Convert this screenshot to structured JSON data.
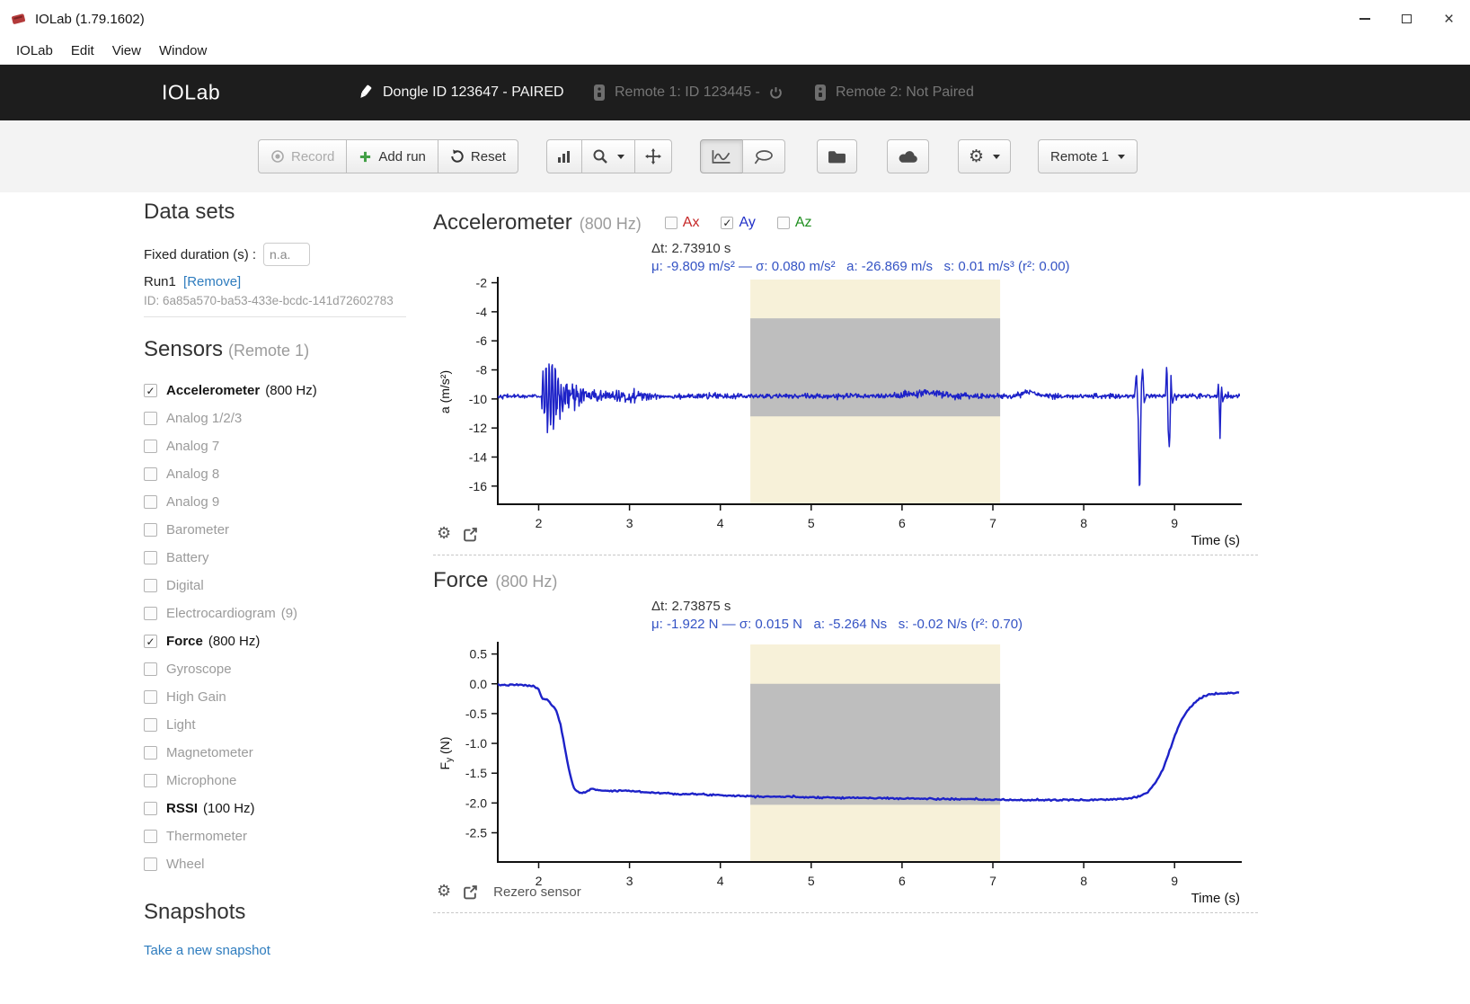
{
  "window": {
    "title": "IOLab (1.79.1602)"
  },
  "menu": [
    "IOLab",
    "Edit",
    "View",
    "Window"
  ],
  "header": {
    "brand": "IOLab",
    "dongle": "Dongle ID 123647 - PAIRED",
    "remote1": "Remote 1: ID 123445 -",
    "remote2": "Remote 2: Not Paired"
  },
  "toolbar": {
    "record": "Record",
    "add_run": "Add run",
    "reset": "Reset",
    "remote_select": "Remote 1"
  },
  "colors": {
    "series_blue": "#1d22c8",
    "stats_blue": "#3453c4",
    "link_blue": "#2e7cbe",
    "selection_yellow": "#f7f1d9",
    "selection_grey": "rgba(112,118,152,0.42)",
    "add_run_green": "#43a047"
  },
  "sidebar": {
    "datasets_title": "Data sets",
    "fixed_duration_label": "Fixed duration (s) :",
    "fixed_duration_value": "n.a.",
    "run_name": "Run1",
    "run_remove": "[Remove]",
    "run_id": "ID: 6a85a570-ba53-433e-bcdc-141d72602783",
    "sensors_title": "Sensors",
    "sensors_subtitle": "(Remote 1)",
    "sensors": [
      {
        "name": "Accelerometer",
        "rate": "(800 Hz)",
        "checked": true,
        "bold": true
      },
      {
        "name": "Analog 1/2/3",
        "rate": "",
        "checked": false,
        "bold": false
      },
      {
        "name": "Analog 7",
        "rate": "",
        "checked": false,
        "bold": false
      },
      {
        "name": "Analog 8",
        "rate": "",
        "checked": false,
        "bold": false
      },
      {
        "name": "Analog 9",
        "rate": "",
        "checked": false,
        "bold": false
      },
      {
        "name": "Barometer",
        "rate": "",
        "checked": false,
        "bold": false
      },
      {
        "name": "Battery",
        "rate": "",
        "checked": false,
        "bold": false
      },
      {
        "name": "Digital",
        "rate": "",
        "checked": false,
        "bold": false
      },
      {
        "name": "Electrocardiogram",
        "rate": "(9)",
        "checked": false,
        "bold": false
      },
      {
        "name": "Force",
        "rate": "(800 Hz)",
        "checked": true,
        "bold": true
      },
      {
        "name": "Gyroscope",
        "rate": "",
        "checked": false,
        "bold": false
      },
      {
        "name": "High Gain",
        "rate": "",
        "checked": false,
        "bold": false
      },
      {
        "name": "Light",
        "rate": "",
        "checked": false,
        "bold": false
      },
      {
        "name": "Magnetometer",
        "rate": "",
        "checked": false,
        "bold": false
      },
      {
        "name": "Microphone",
        "rate": "",
        "checked": false,
        "bold": false
      },
      {
        "name": "RSSI",
        "rate": "(100 Hz)",
        "checked": false,
        "bold": true
      },
      {
        "name": "Thermometer",
        "rate": "",
        "checked": false,
        "bold": false
      },
      {
        "name": "Wheel",
        "rate": "",
        "checked": false,
        "bold": false
      }
    ],
    "snapshots_title": "Snapshots",
    "snapshot_link": "Take a new snapshot"
  },
  "chart_data": [
    {
      "type": "line",
      "title": "Accelerometer",
      "title_rate": "(800 Hz)",
      "xlabel": "Time (s)",
      "ylabel": "a (m/s²)",
      "xlim": [
        1.55,
        9.72
      ],
      "ylim": [
        -17.25,
        -1.78
      ],
      "xticks": [
        {
          "v": 2,
          "l": "2"
        },
        {
          "v": 3,
          "l": "3"
        },
        {
          "v": 4,
          "l": "4"
        },
        {
          "v": 5,
          "l": "5"
        },
        {
          "v": 6,
          "l": "6"
        },
        {
          "v": 7,
          "l": "7"
        },
        {
          "v": 8,
          "l": "8"
        },
        {
          "v": 9,
          "l": "9"
        }
      ],
      "yticks": [
        {
          "v": -2,
          "l": "-2"
        },
        {
          "v": -4,
          "l": "-4"
        },
        {
          "v": -6,
          "l": "-6"
        },
        {
          "v": -8,
          "l": "-8"
        },
        {
          "v": -10,
          "l": "-10"
        },
        {
          "v": -12,
          "l": "-12"
        },
        {
          "v": -14,
          "l": "-14"
        },
        {
          "v": -16,
          "l": "-16"
        }
      ],
      "legend": [
        {
          "label": "Ax",
          "color": "#c62828",
          "checked": false
        },
        {
          "label": "Ay",
          "color": "#2231c8",
          "checked": true
        },
        {
          "label": "Az",
          "color": "#1e8e1e",
          "checked": false
        }
      ],
      "series_color": "#1d22c8",
      "stroke_width": 1.5,
      "stats1": "Δt: 2.73910 s",
      "stats2": "μ: -9.809 m/s² — σ: 0.080 m/s²   a: -26.869 m/s   s: 0.01 m/s³ (r²: 0.00)",
      "stats_color": "#3453c4",
      "selection": {
        "x0": 4.33,
        "x1": 7.08,
        "fill": "#f7f1d9"
      },
      "stat_box": {
        "v0": -4.45,
        "v1": -11.2,
        "fill": "rgba(112,118,152,0.42)"
      },
      "signal": {
        "baseline": -9.81,
        "dt": 0.006,
        "seed": 42,
        "noise_default": 0.085,
        "noise": [
          {
            "t0": 1.55,
            "t1": 2.03,
            "sigma": 0.06
          },
          {
            "t0": 2.03,
            "t1": 2.52,
            "sigma": 0.45
          },
          {
            "t0": 2.52,
            "t1": 3.25,
            "sigma": 0.2
          },
          {
            "t0": 5.9,
            "t1": 6.7,
            "sigma": 0.13
          }
        ],
        "burst": {
          "t0": 2.03,
          "t1": 2.5,
          "center": 2.14,
          "width": 0.1,
          "amp": 2.5,
          "freq": 30
        },
        "bumps": [
          {
            "t": 6.3,
            "amp": 0.22,
            "width": 0.22
          },
          {
            "t": 7.4,
            "amp": 0.3,
            "width": 0.1
          }
        ],
        "spikes": [
          [
            [
              8.56,
              -9.8
            ],
            [
              8.58,
              -8.1
            ],
            [
              8.6,
              -11.5
            ],
            [
              8.615,
              -17.1
            ],
            [
              8.635,
              -8.9
            ],
            [
              8.65,
              -7.8
            ],
            [
              8.665,
              -10.3
            ],
            [
              8.685,
              -9.8
            ]
          ],
          [
            [
              8.9,
              -9.8
            ],
            [
              8.915,
              -7.3
            ],
            [
              8.93,
              -12.1
            ],
            [
              8.945,
              -13.6
            ],
            [
              8.96,
              -8.4
            ],
            [
              8.975,
              -10.4
            ],
            [
              8.995,
              -9.8
            ]
          ],
          [
            [
              9.47,
              -9.85
            ],
            [
              9.485,
              -8.8
            ],
            [
              9.5,
              -12.7
            ],
            [
              9.515,
              -8.9
            ],
            [
              9.53,
              -10.2
            ],
            [
              9.55,
              -9.8
            ]
          ]
        ]
      }
    },
    {
      "type": "line",
      "title": "Force",
      "title_rate": "(800 Hz)",
      "xlabel": "Time (s)",
      "ylabel": "Fy (N)",
      "ylabel_main": "F",
      "ylabel_sub": "y",
      "ylabel_rest": " (N)",
      "xlim": [
        1.55,
        9.72
      ],
      "ylim": [
        -2.99,
        0.66
      ],
      "xticks": [
        {
          "v": 2,
          "l": "2"
        },
        {
          "v": 3,
          "l": "3"
        },
        {
          "v": 4,
          "l": "4"
        },
        {
          "v": 5,
          "l": "5"
        },
        {
          "v": 6,
          "l": "6"
        },
        {
          "v": 7,
          "l": "7"
        },
        {
          "v": 8,
          "l": "8"
        },
        {
          "v": 9,
          "l": "9"
        }
      ],
      "yticks": [
        {
          "v": 0.5,
          "l": "0.5"
        },
        {
          "v": 0,
          "l": "0.0"
        },
        {
          "v": -0.5,
          "l": "-0.5"
        },
        {
          "v": -1,
          "l": "-1.0"
        },
        {
          "v": -1.5,
          "l": "-1.5"
        },
        {
          "v": -2,
          "l": "-2.0"
        },
        {
          "v": -2.5,
          "l": "-2.5"
        }
      ],
      "series_color": "#1d22c8",
      "stroke_width": 2.4,
      "stats1": "Δt: 2.73875 s",
      "stats2": "μ: -1.922 N — σ: 0.015 N   a: -5.264 Ns   s: -0.02 N/s (r²: 0.70)",
      "stats_color": "#3453c4",
      "selection": {
        "x0": 4.33,
        "x1": 7.08,
        "fill": "#f7f1d9"
      },
      "stat_box": {
        "v0": 0.0,
        "v1": -2.03,
        "fill": "rgba(112,118,152,0.42)"
      },
      "dt": 0.015,
      "seed": 7,
      "noise_sigma": 0.007,
      "points": [
        [
          1.55,
          -0.02
        ],
        [
          1.8,
          -0.02
        ],
        [
          1.95,
          -0.04
        ],
        [
          2.0,
          -0.1
        ],
        [
          2.03,
          -0.22
        ],
        [
          2.06,
          -0.26
        ],
        [
          2.1,
          -0.27
        ],
        [
          2.13,
          -0.33
        ],
        [
          2.17,
          -0.4
        ],
        [
          2.2,
          -0.46
        ],
        [
          2.24,
          -0.7
        ],
        [
          2.28,
          -1.0
        ],
        [
          2.32,
          -1.35
        ],
        [
          2.36,
          -1.62
        ],
        [
          2.4,
          -1.78
        ],
        [
          2.45,
          -1.83
        ],
        [
          2.5,
          -1.82
        ],
        [
          2.56,
          -1.78
        ],
        [
          2.62,
          -1.77
        ],
        [
          2.7,
          -1.79
        ],
        [
          2.8,
          -1.8
        ],
        [
          2.95,
          -1.79
        ],
        [
          3.1,
          -1.81
        ],
        [
          3.3,
          -1.83
        ],
        [
          3.6,
          -1.85
        ],
        [
          3.9,
          -1.86
        ],
        [
          4.2,
          -1.88
        ],
        [
          4.5,
          -1.89
        ],
        [
          4.9,
          -1.9
        ],
        [
          5.3,
          -1.91
        ],
        [
          5.8,
          -1.92
        ],
        [
          6.3,
          -1.93
        ],
        [
          6.8,
          -1.94
        ],
        [
          7.2,
          -1.95
        ],
        [
          7.6,
          -1.95
        ],
        [
          8.0,
          -1.95
        ],
        [
          8.3,
          -1.94
        ],
        [
          8.5,
          -1.92
        ],
        [
          8.58,
          -1.9
        ],
        [
          8.64,
          -1.87
        ],
        [
          8.7,
          -1.82
        ],
        [
          8.76,
          -1.72
        ],
        [
          8.82,
          -1.58
        ],
        [
          8.88,
          -1.4
        ],
        [
          8.93,
          -1.2
        ],
        [
          8.97,
          -1.02
        ],
        [
          9.0,
          -0.88
        ],
        [
          9.03,
          -0.76
        ],
        [
          9.06,
          -0.65
        ],
        [
          9.09,
          -0.57
        ],
        [
          9.12,
          -0.5
        ],
        [
          9.16,
          -0.42
        ],
        [
          9.2,
          -0.35
        ],
        [
          9.25,
          -0.28
        ],
        [
          9.3,
          -0.23
        ],
        [
          9.36,
          -0.19
        ],
        [
          9.45,
          -0.17
        ],
        [
          9.55,
          -0.16
        ],
        [
          9.72,
          -0.15
        ]
      ],
      "footer_link": "Rezero sensor"
    }
  ]
}
